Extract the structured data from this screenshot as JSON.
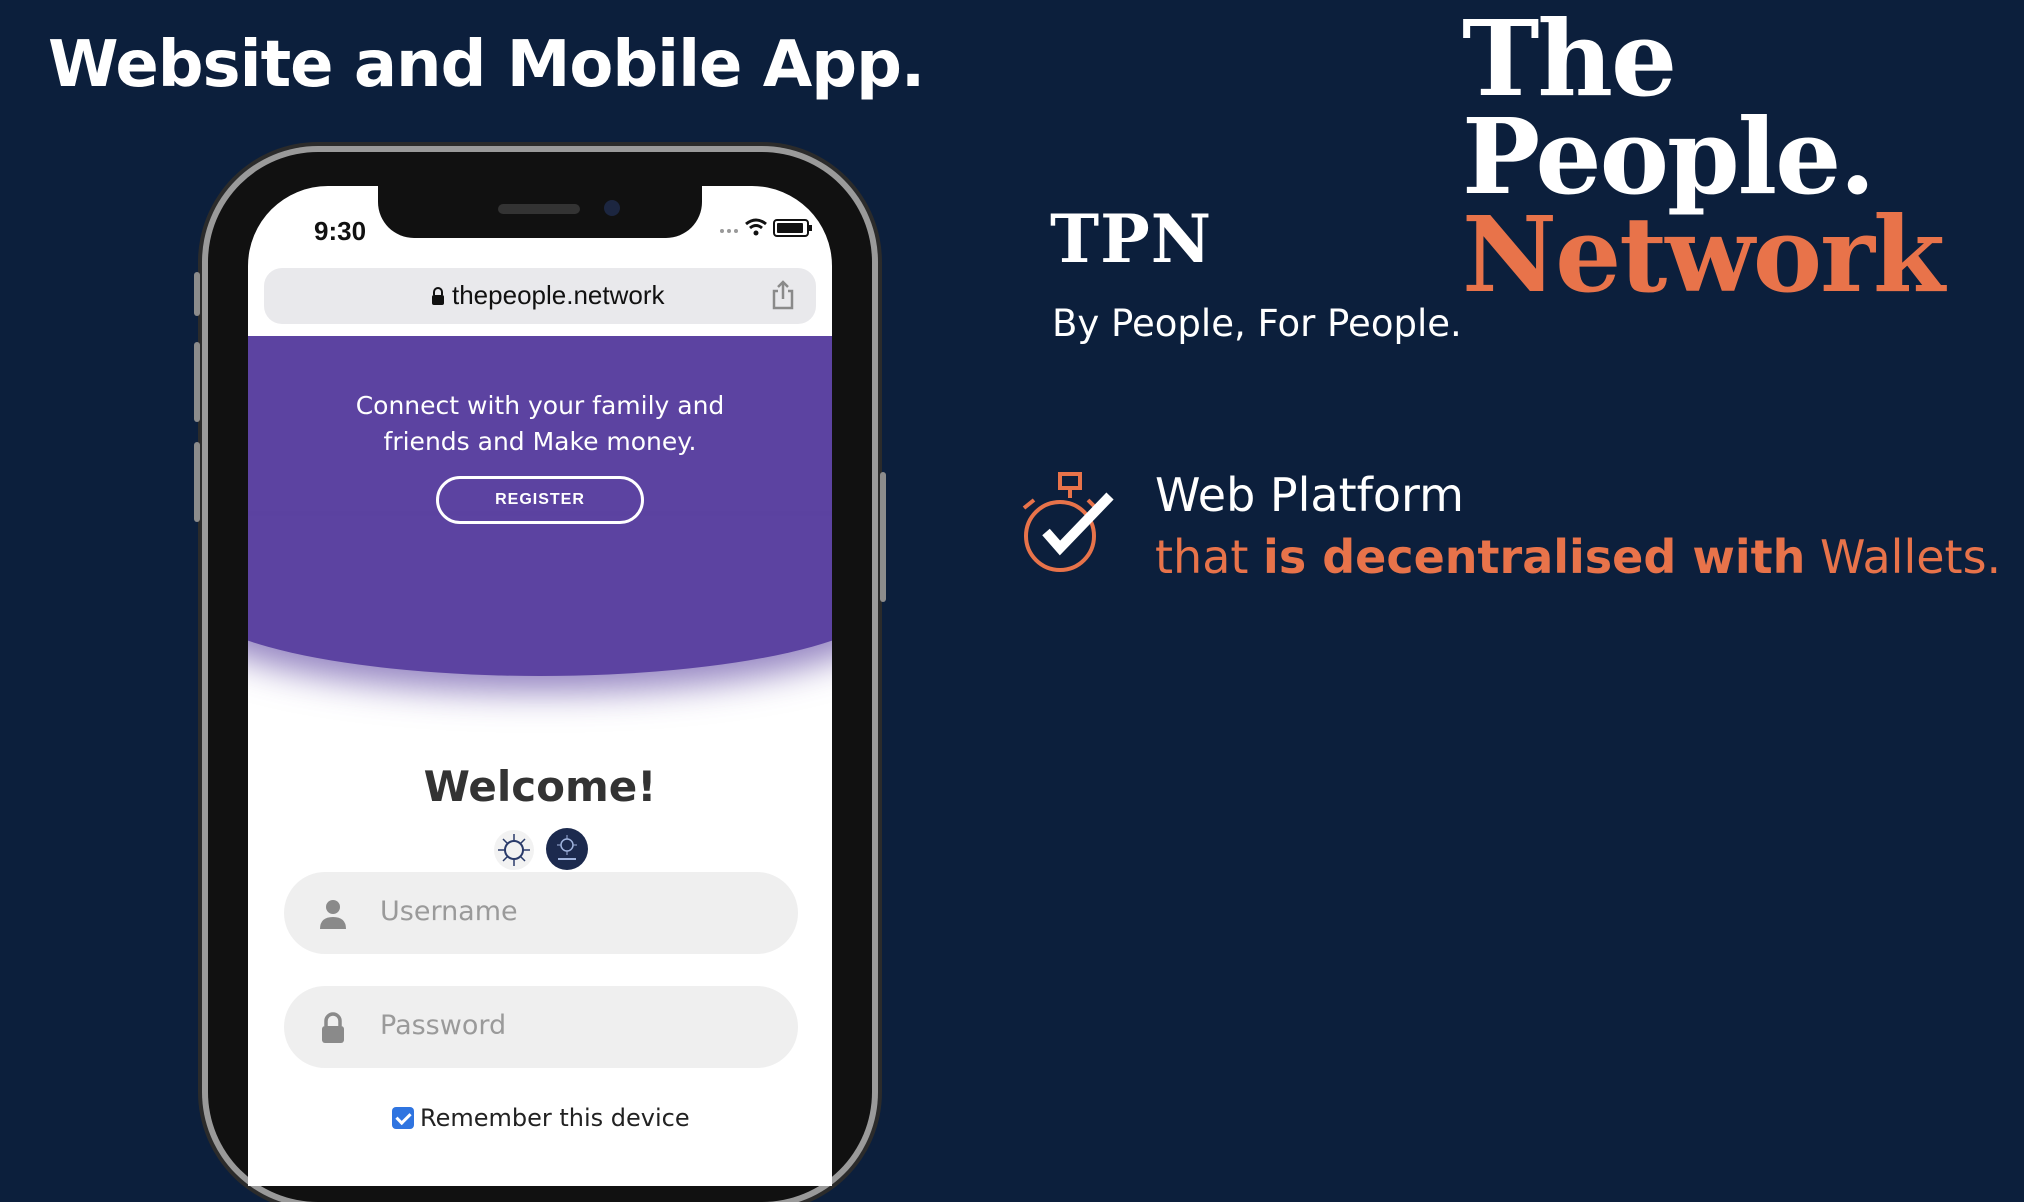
{
  "slide": {
    "title": "Website and Mobile App."
  },
  "brand": {
    "logo_line1": "The",
    "logo_line2": "People.",
    "logo_line3": "Network",
    "short_name": "TPN",
    "tagline": "By People, For People.",
    "accent_color": "#e8734a",
    "background_color": "#0c1f3c"
  },
  "feature": {
    "icon": "stopwatch-check-icon",
    "line1": "Web Platform",
    "line2_prefix": "that ",
    "line2_bold": "is decentralised with",
    "line2_suffix": " Wallets."
  },
  "phone": {
    "status_time": "9:30",
    "url": "thepeople.network",
    "hero_text_line1": "Connect with your family and",
    "hero_text_line2": "friends and Make money.",
    "register_label": "REGISTER",
    "welcome": "Welcome!",
    "username_placeholder": "Username",
    "password_placeholder": "Password",
    "remember_label": "Remember this device",
    "hero_color": "#5c43a1"
  }
}
